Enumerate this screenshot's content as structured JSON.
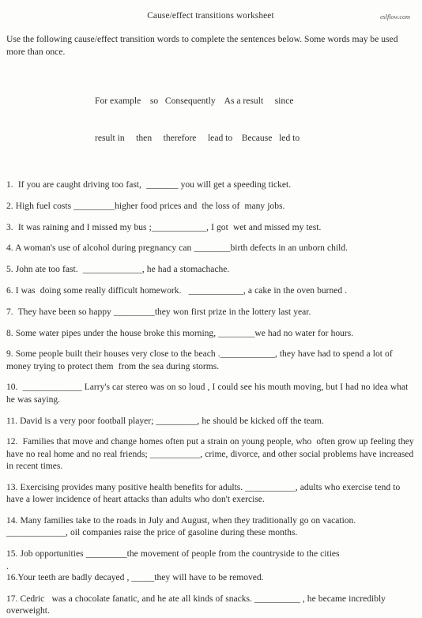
{
  "header": {
    "title": "Cause/effect transitions worksheet",
    "site_mark": "eslflow.com"
  },
  "instructions": "Use the  following cause/effect transition words to complete the  sentences below. Some words may be used more than once.",
  "word_bank": {
    "row1": "For example    so   Consequently    As a result     since",
    "row2": "result in     then     therefore     lead to    Because   led to",
    "words": [
      "For example",
      "so",
      "Consequently",
      "As a result",
      "since",
      "result in",
      "then",
      "therefore",
      "lead to",
      "Because",
      "led to"
    ]
  },
  "questions": [
    {
      "id": 1,
      "text": "1.  If you are caught driving too fast,  _______ you will get a speeding ticket."
    },
    {
      "id": 2,
      "text": "2. High fuel costs _________higher food prices and  the loss of  many jobs."
    },
    {
      "id": 3,
      "text": "3.  It was raining and I missed my bus ;____________, I got  wet and missed my test."
    },
    {
      "id": 4,
      "text": "4. A woman's use of alcohol during pregnancy can ________birth defects in an unborn child."
    },
    {
      "id": 5,
      "text": "5. John ate too fast.  _____________, he had a stomachache."
    },
    {
      "id": 6,
      "text": "6. I was  doing some really difficult homework.   ____________, a cake in the oven burned ."
    },
    {
      "id": 7,
      "text": "7.  They have been so happy _________they won first prize in the lottery last year."
    },
    {
      "id": 8,
      "text": "8. Some water pipes under the house broke this morning, ________we had no water for hours."
    },
    {
      "id": 9,
      "text": "9. Some people built their houses very close to the beach .____________, they have had to spend a lot of money trying to protect them  from the sea during storms."
    },
    {
      "id": 10,
      "text": "10.  _____________ Larry's car stereo was on so loud , I could see his mouth moving, but I had no idea what he was saying."
    },
    {
      "id": 11,
      "text": "11. David is a very poor football player; _________, he should be kicked off the team."
    },
    {
      "id": 12,
      "text": "12.  Families that move and change homes often put a strain on young people, who  often grow up feeling they have no real home and no real friends; ___________, crime, divorce, and other social problems have increased in recent times."
    },
    {
      "id": 13,
      "text": "13. Exercising provides many positive health benefits for adults. ___________, adults who exercise tend to have a lower incidence of heart attacks than adults who don't exercise."
    },
    {
      "id": 14,
      "text": "14. Many families take to the roads in July and August, when they traditionally go on vacation. _____________, oil companies raise the price of gasoline during these months."
    },
    {
      "id": 15,
      "text": "15. Job opportunities _________the movement of people from the countryside to the cities"
    },
    {
      "id": 16,
      "text": "."
    },
    {
      "id": 17,
      "text": "16.Your teeth are badly decayed , _____they will have to be removed."
    },
    {
      "id": 18,
      "text": "17. Cedric   was a chocolate fanatic, and he ate all kinds of snacks. __________ , he became incredibly overweight."
    }
  ]
}
